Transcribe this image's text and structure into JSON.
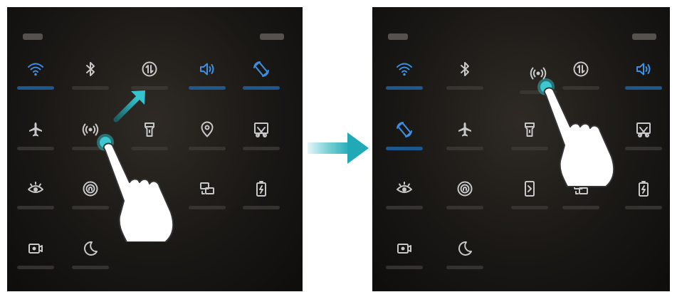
{
  "colors": {
    "active": "#3a8fe6",
    "inactive": "#c8c8c8",
    "accent": "#2fb5be"
  },
  "panels": [
    {
      "name": "before",
      "tiles": [
        {
          "icon": "wifi-icon",
          "active": true
        },
        {
          "icon": "bluetooth-icon",
          "active": false
        },
        {
          "icon": "mobile-data-icon",
          "active": false
        },
        {
          "icon": "sound-icon",
          "active": true
        },
        {
          "icon": "auto-rotate-icon",
          "active": true
        },
        {
          "icon": "airplane-icon",
          "active": false
        },
        {
          "icon": "hotspot-icon",
          "active": false
        },
        {
          "icon": "flashlight-icon",
          "active": false
        },
        {
          "icon": "location-icon",
          "active": false
        },
        {
          "icon": "screenshot-icon",
          "active": false
        },
        {
          "icon": "eye-comfort-icon",
          "active": false
        },
        {
          "icon": "nfc-icon",
          "active": false
        },
        {
          "icon": "blank",
          "active": false
        },
        {
          "icon": "screen-projection-icon",
          "active": false
        },
        {
          "icon": "power-saving-icon",
          "active": false
        },
        {
          "icon": "screen-recorder-icon",
          "active": false
        },
        {
          "icon": "do-not-disturb-icon",
          "active": false
        }
      ]
    },
    {
      "name": "after",
      "tiles": [
        {
          "icon": "wifi-icon",
          "active": true
        },
        {
          "icon": "bluetooth-icon",
          "active": false
        },
        {
          "icon": "hotspot-icon",
          "active": false
        },
        {
          "icon": "mobile-data-icon",
          "active": false
        },
        {
          "icon": "sound-icon",
          "active": true
        },
        {
          "icon": "auto-rotate-icon",
          "active": true
        },
        {
          "icon": "airplane-icon",
          "active": false
        },
        {
          "icon": "flashlight-icon",
          "active": false
        },
        {
          "icon": "blank",
          "active": false
        },
        {
          "icon": "screenshot-icon",
          "active": false
        },
        {
          "icon": "eye-comfort-icon",
          "active": false
        },
        {
          "icon": "nfc-icon",
          "active": false
        },
        {
          "icon": "phone-clone-icon",
          "active": false
        },
        {
          "icon": "screen-projection-icon",
          "active": false
        },
        {
          "icon": "power-saving-icon",
          "active": false
        },
        {
          "icon": "screen-recorder-icon",
          "active": false
        },
        {
          "icon": "do-not-disturb-icon",
          "active": false
        }
      ]
    }
  ]
}
